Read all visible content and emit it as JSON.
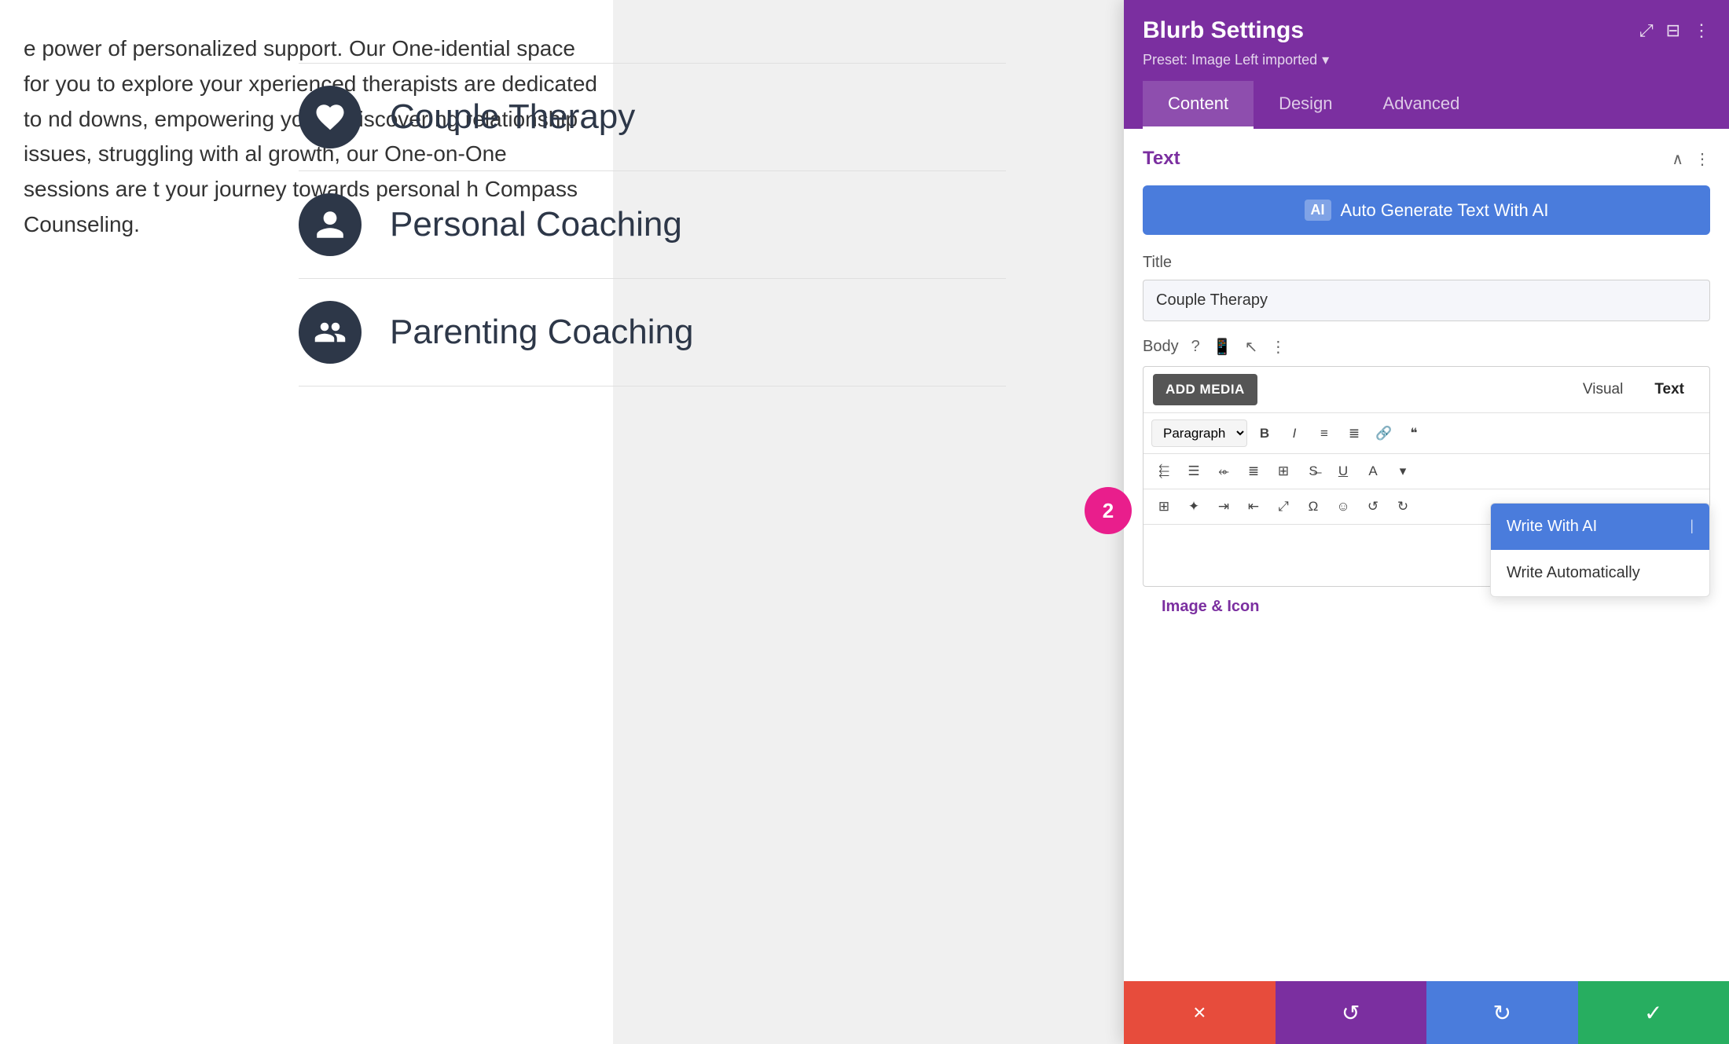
{
  "left": {
    "body_text": "e power of personalized support. Our One-idential space for you to explore your xperienced therapists are dedicated to nd downs, empowering you to discover ng relationship issues, struggling with al growth, our One-on-One sessions are t your journey towards personal h Compass Counseling."
  },
  "services": [
    {
      "name": "Couple Therapy",
      "icon_type": "heart"
    },
    {
      "name": "Personal Coaching",
      "icon_type": "person"
    },
    {
      "name": "Parenting Coaching",
      "icon_type": "family"
    }
  ],
  "settings": {
    "title": "Blurb Settings",
    "preset": "Preset: Image Left imported",
    "tabs": [
      "Content",
      "Design",
      "Advanced"
    ],
    "active_tab": "Content",
    "section_title": "Text",
    "ai_button_label": "Auto Generate Text With AI",
    "title_label": "Title",
    "title_value": "Couple Therapy",
    "body_label": "Body",
    "add_media_label": "ADD MEDIA",
    "view_tabs": [
      "Visual",
      "Text"
    ],
    "active_view_tab": "Text",
    "paragraph_select": "Paragraph",
    "ai_floating_label": "AI",
    "image_icon_label": "Image & Icon",
    "dropdown": {
      "items": [
        {
          "label": "Write With AI",
          "type": "primary"
        },
        {
          "label": "Write Automatically",
          "type": "secondary"
        }
      ]
    }
  },
  "action_bar": {
    "cancel_icon": "×",
    "undo_icon": "↺",
    "redo_icon": "↻",
    "confirm_icon": "✓"
  },
  "badge": {
    "number": "2"
  }
}
